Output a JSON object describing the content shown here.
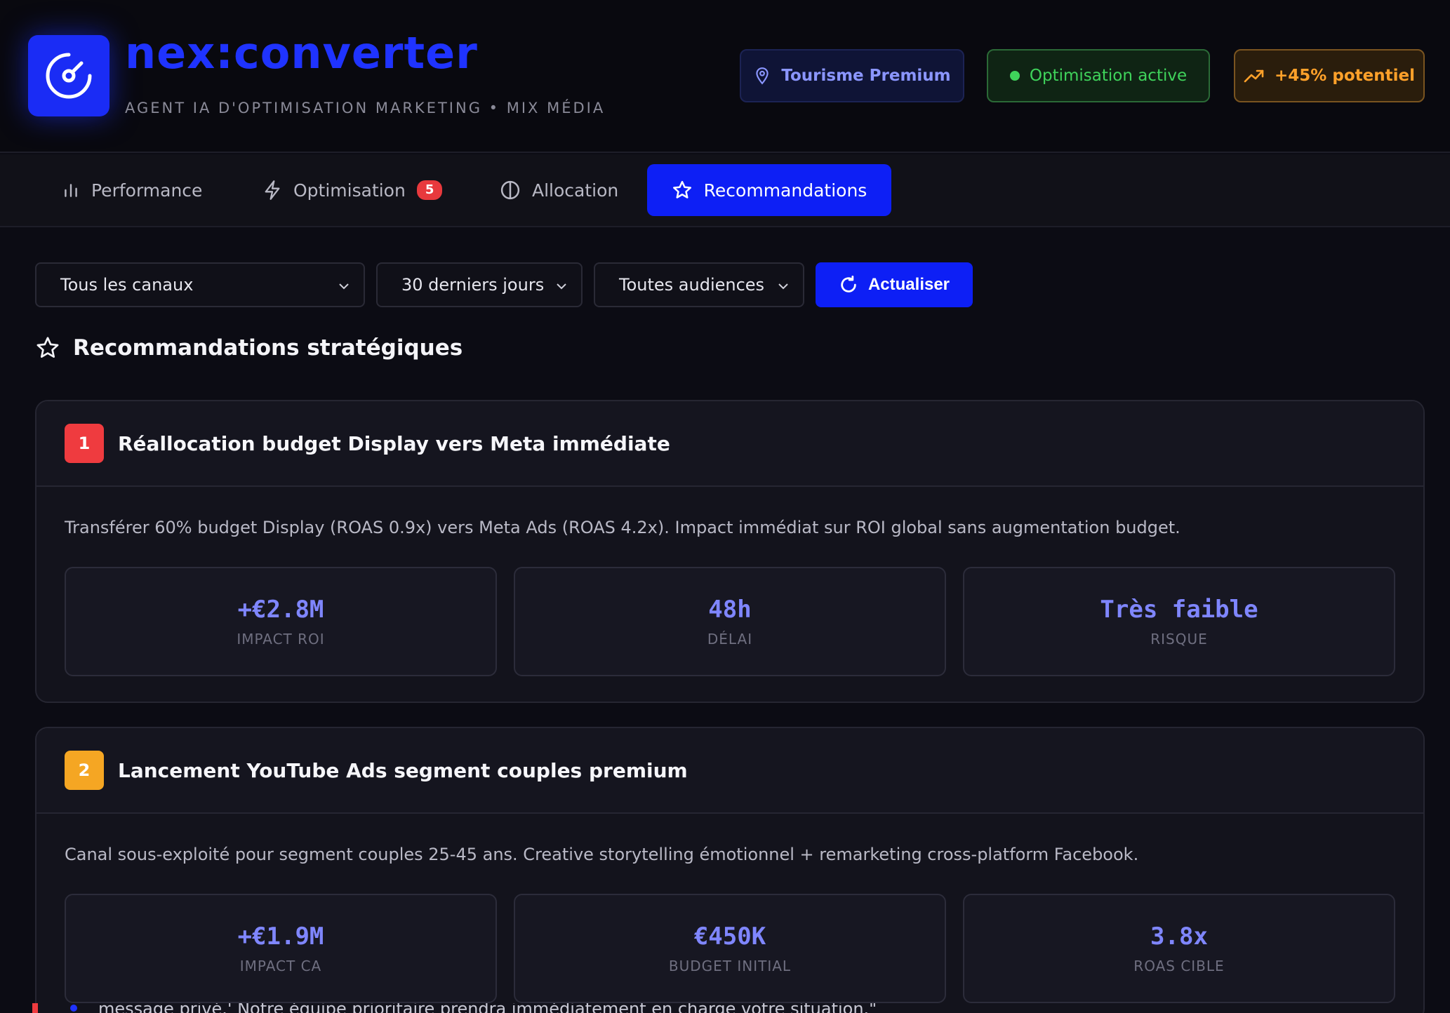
{
  "header": {
    "brand": "nex:converter",
    "subtitle": "AGENT IA D'OPTIMISATION MARKETING • MIX MÉDIA",
    "pills": {
      "tourisme": "Tourisme Premium",
      "optimisation": "Optimisation active",
      "potentiel": "+45% potentiel"
    }
  },
  "tabs": {
    "performance": "Performance",
    "optimisation": "Optimisation",
    "optimisation_badge": "5",
    "allocation": "Allocation",
    "recommandations": "Recommandations"
  },
  "filters": {
    "canaux": "Tous les canaux",
    "periode": "30 derniers jours",
    "audiences": "Toutes audiences",
    "refresh": "Actualiser"
  },
  "section": {
    "title": "Recommandations stratégiques"
  },
  "recommendations": [
    {
      "number": "1",
      "title": "Réallocation budget Display vers Meta immédiate",
      "description": "Transférer 60% budget Display (ROAS 0.9x) vers Meta Ads (ROAS 4.2x). Impact immédiat sur ROI global sans augmentation budget.",
      "metrics": [
        {
          "value": "+€2.8M",
          "label": "IMPACT ROI"
        },
        {
          "value": "48h",
          "label": "DÉLAI"
        },
        {
          "value": "Très faible",
          "label": "RISQUE"
        }
      ]
    },
    {
      "number": "2",
      "title": "Lancement YouTube Ads segment couples premium",
      "description": "Canal sous-exploité pour segment couples 25-45 ans. Creative storytelling émotionnel + remarketing cross-platform Facebook.",
      "metrics": [
        {
          "value": "+€1.9M",
          "label": "IMPACT CA"
        },
        {
          "value": "€450K",
          "label": "BUDGET INITIAL"
        },
        {
          "value": "3.8x",
          "label": "ROAS CIBLE"
        }
      ]
    }
  ],
  "toast": {
    "text": "message privé.' Notre équipe prioritaire prendra immédiatement en charge votre situation.\""
  },
  "colors": {
    "accent": "#1f33ff",
    "active_tab": "#0d1ff5",
    "metric_value": "#7f86ff",
    "priority_high": "#ef3b3f",
    "priority_medium": "#f5a623",
    "status_green": "#3fd35b",
    "potential_orange": "#ffa12a"
  },
  "icons": {
    "logo": "gauge-icon",
    "tourisme": "map-pin-icon",
    "optimisation": "status-dot-icon",
    "potentiel": "trending-up-icon",
    "performance": "bar-chart-icon",
    "optimisation_tab": "lightning-icon",
    "allocation": "pie-half-icon",
    "recommandations": "star-icon",
    "refresh": "refresh-icon",
    "select": "chevron-down-icon"
  }
}
